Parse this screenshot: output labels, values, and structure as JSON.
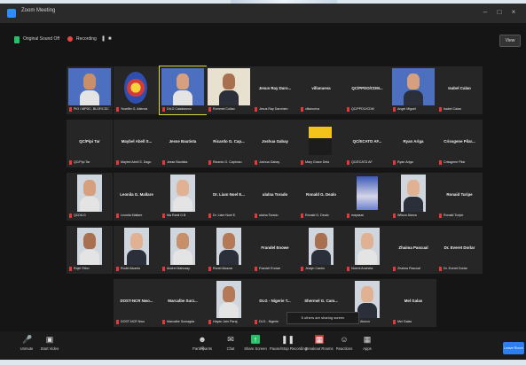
{
  "window": {
    "title": "Zoom Meeting"
  },
  "info": {
    "meeting_id": "Original Sound Off",
    "recording": "Recording",
    "view_label": "View"
  },
  "row1": [
    {
      "type": "photo",
      "caption": "PIO / MPDC, BLGF/CSC"
    },
    {
      "type": "logo",
      "caption": "Yuseflin G. Atienza"
    },
    {
      "type": "photo",
      "caption": "DILG Calabarzon",
      "active": true
    },
    {
      "type": "photo2",
      "caption": "Rommel Coliao"
    },
    {
      "type": "name",
      "name": "Jesus Ray Daro...",
      "caption": "Jesus Ray Daromen"
    },
    {
      "type": "name",
      "name": "villanueva",
      "caption": "villanueva"
    },
    {
      "type": "name",
      "name": "QC/PPDO/CDM...",
      "caption": "QC/PPDO/CDM"
    },
    {
      "type": "photo",
      "caption": "Angel Miguel"
    },
    {
      "type": "name",
      "name": "Isabel Calao",
      "caption": "Isabel Calao"
    }
  ],
  "row2": [
    {
      "type": "name",
      "name": "QC/Pipi Tar",
      "caption": "QC/Pipi Tar"
    },
    {
      "type": "name",
      "name": "Maybel Abell S...",
      "caption": "Maybel Abell S. Dagu"
    },
    {
      "type": "name",
      "name": "Jesse Bautista",
      "caption": "Jesse Bautista"
    },
    {
      "type": "name",
      "name": "Ricardo G. Cap...",
      "caption": "Ricardo G. Capiroso"
    },
    {
      "type": "name",
      "name": "Joshua Gabay",
      "caption": "Joshua Gabay"
    },
    {
      "type": "doc",
      "caption": "Mary Grace Dela"
    },
    {
      "type": "name",
      "name": "QC/ECATD AF...",
      "caption": "QC/ECATD AF"
    },
    {
      "type": "name",
      "name": "Ryan Ariga",
      "caption": "Ryan Ariga"
    },
    {
      "type": "name",
      "name": "Crissgene Pilar...",
      "caption": "Crissgene Pilar"
    }
  ],
  "row3": [
    {
      "type": "photo",
      "caption": "QCDILG"
    },
    {
      "type": "name",
      "name": "Leonila G. Mallare",
      "caption": "Leonila Mallare"
    },
    {
      "type": "photo",
      "caption": "Ma Ranil G.B"
    },
    {
      "type": "name",
      "name": "Dr. Liam Noel E...",
      "caption": "Dr. Liam Noel E."
    },
    {
      "type": "name",
      "name": "ulalna Torado",
      "caption": "ulalna Torado"
    },
    {
      "type": "name",
      "name": "Ronald G. Dealo",
      "caption": "Ronald G. Dealo"
    },
    {
      "type": "flag",
      "caption": "mayasat"
    },
    {
      "type": "photo",
      "caption": "Wilson Alarca"
    },
    {
      "type": "name",
      "name": "Ronaid Turipe",
      "caption": "Ronaid Turipe"
    }
  ],
  "row4": [
    {
      "type": "photo",
      "caption": "Rojel Rifon"
    },
    {
      "type": "photo",
      "caption": "Rodel Alcanto"
    },
    {
      "type": "photo",
      "caption": "Andrei Mahusay"
    },
    {
      "type": "photo",
      "caption": "Ronel Alcazar"
    },
    {
      "type": "name",
      "name": "Frandel Enowe",
      "caption": "Frandel Enowe"
    },
    {
      "type": "photo",
      "caption": "Jealyn Castro"
    },
    {
      "type": "photo",
      "caption": "Noemi Ancheta"
    },
    {
      "type": "name",
      "name": "Zhaima Pascual",
      "caption": "Zhaima Pascual"
    },
    {
      "type": "name",
      "name": "Dr. Everet Dorlar",
      "caption": "Dr. Everet Dorlar"
    }
  ],
  "row5": [
    {
      "type": "name",
      "name": "DOST-NCR Nwo...",
      "caption": "DOST-NCR Nwo"
    },
    {
      "type": "name",
      "name": "Marcalbe Surz...",
      "caption": "Marcalbe Sumagda"
    },
    {
      "type": "photo",
      "caption": "Hayan Jain Paraj"
    },
    {
      "type": "name",
      "name": "DLG - Nigerie T...",
      "caption": "DLG - Nigerie"
    },
    {
      "type": "name",
      "name": "Shermel G. Cam...",
      "caption": "Shermel G. Cam"
    },
    {
      "type": "photo",
      "caption": "Rolex Alonzo"
    },
    {
      "type": "name",
      "name": "Mel Galas",
      "caption": "Mel Galas"
    }
  ],
  "tooltip": "5 others are sharing screen",
  "toolbar": {
    "unmute": "Unmute",
    "video": "Start Video",
    "participants": "Participants",
    "participants_count": "42",
    "chat": "Chat",
    "share": "Share Screen",
    "pause": "Pause/Stop Recording",
    "breakout": "Breakout Rooms",
    "reactions": "Reactions",
    "apps": "Apps",
    "end": "Leave Room"
  },
  "colors": {
    "accent": "#2d8cff",
    "record": "#e84545",
    "share": "#26c06a",
    "window": "#151515"
  }
}
